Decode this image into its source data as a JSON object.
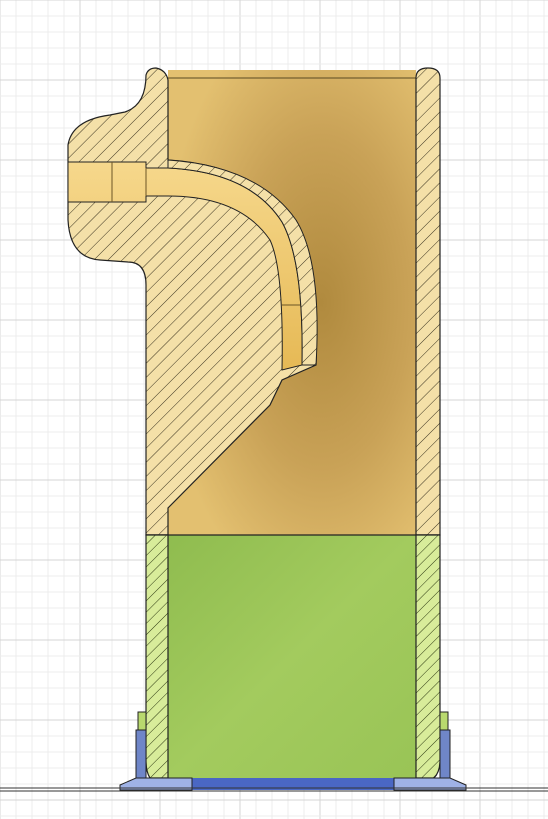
{
  "view": {
    "type": "cad-section-view",
    "background": "#ffffff",
    "grid": true
  },
  "colors": {
    "grid_minor": "#ececec",
    "grid_major": "#d4d4d4",
    "hatch_body": "#3b3420",
    "body_fill": "#f4e0a8",
    "interior_tan": "#d9b466",
    "interior_tan_dark": "#b08a3e",
    "channel_fill": "#f1c96a",
    "green_fill": "#9cc65a",
    "green_hatch_fill": "#d8ec9a",
    "blue_fill": "#6f86c8",
    "blue_dark": "#3c57a8",
    "outline": "#222222"
  },
  "components": [
    {
      "id": "upper-body",
      "label": "",
      "icon": "hatched-section"
    },
    {
      "id": "lower-sleeve",
      "label": "",
      "icon": "green-section"
    },
    {
      "id": "base-plate",
      "label": "",
      "icon": "blue-section"
    }
  ]
}
